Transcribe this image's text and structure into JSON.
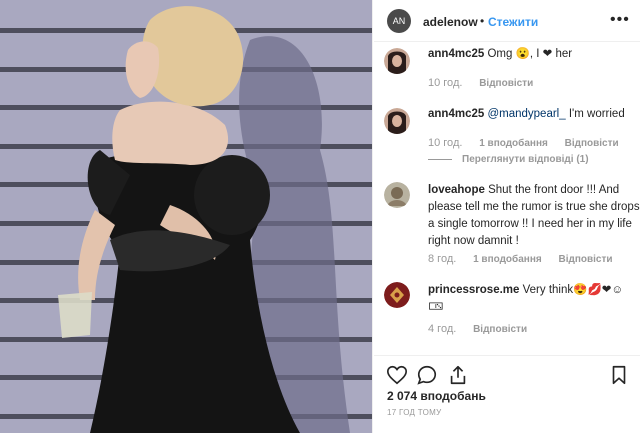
{
  "header": {
    "avatar_text": "AN",
    "username": "adelenow",
    "separator": "•",
    "follow_label": "Стежити",
    "more_icon": "more-dots-icon"
  },
  "comments": [
    {
      "username": "ann4mc25",
      "text": "Omg 😮, I ❤ her",
      "time": "10 год.",
      "reply_label": "Відповісти"
    },
    {
      "username": "ann4mc25",
      "mention": "@mandypearl_",
      "text": "I'm worried",
      "time": "10 год.",
      "likes_label": "1 вподобання",
      "reply_label": "Відповісти",
      "view_replies": "Переглянути відповіді (1)"
    },
    {
      "username": "loveahope",
      "text": "Shut the front door !!! And please tell me the rumor is true she drops a single tomorrow !! I need her in my life right now damnit !",
      "time": "8 год.",
      "likes_label": "1 вподобання",
      "reply_label": "Відповісти"
    },
    {
      "username": "princessrose.me",
      "text": "Very think😍💋❤☺ 🀴",
      "time": "4 год.",
      "reply_label": "Відповісти"
    }
  ],
  "actions": {
    "like_icon": "heart-icon",
    "comment_icon": "comment-icon",
    "share_icon": "share-icon",
    "save_icon": "bookmark-icon"
  },
  "likes_count": "2 074 вподобань",
  "time_ago": "17 ГОД ТОМУ",
  "colors": {
    "link": "#3897f0",
    "border": "#efefef",
    "meta": "#999999",
    "photo_wall": "#a9a8c0",
    "dress": "#141414"
  }
}
